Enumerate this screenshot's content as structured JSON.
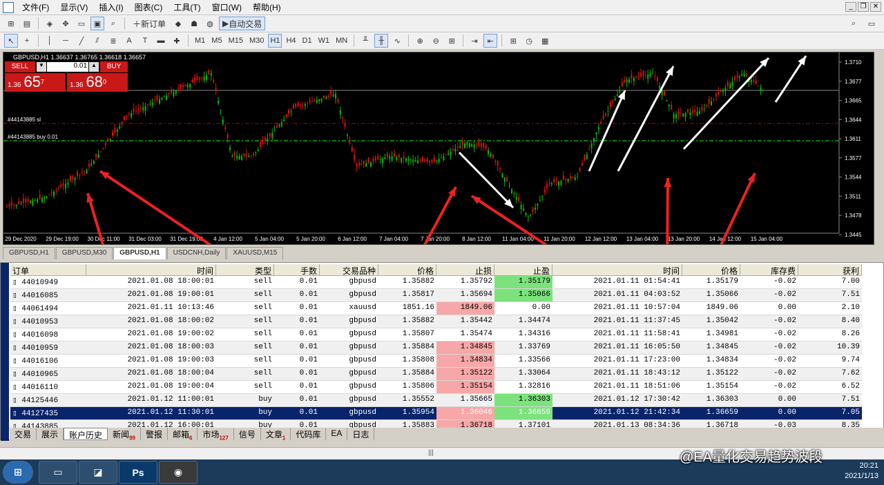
{
  "menu": {
    "items": [
      "文件(F)",
      "显示(V)",
      "插入(I)",
      "图表(C)",
      "工具(T)",
      "窗口(W)",
      "帮助(H)"
    ]
  },
  "toolbar": {
    "new_order": "新订单",
    "auto_trading": "自动交易",
    "timeframes": [
      "M1",
      "M5",
      "M15",
      "M30",
      "H1",
      "H4",
      "D1",
      "W1",
      "MN"
    ],
    "active_tf": "H1"
  },
  "chart": {
    "info": "GBPUSD,H1  1.36637 1.36765 1.36618 1.36657",
    "price_labels": [
      "1.3710",
      "1.3677",
      "1.3665",
      "1.3644",
      "1.3611",
      "1.3577",
      "1.3544",
      "1.3511",
      "1.3478",
      "1.3445"
    ],
    "time_labels": [
      "29 Dec 2020",
      "29 Dec 19:00",
      "30 Dec 11:00",
      "31 Dec 03:00",
      "31 Dec 19:00",
      "4 Jan 12:00",
      "5 Jan 04:00",
      "5 Jan 20:00",
      "6 Jan 12:00",
      "7 Jan 04:00",
      "7 Jan 20:00",
      "8 Jan 12:00",
      "11 Jan 04:00",
      "11 Jan 20:00",
      "12 Jan 12:00",
      "13 Jan 04:00",
      "13 Jan 20:00",
      "14 Jan 12:00",
      "15 Jan 04:00"
    ],
    "sl_label": "#44143885 sl",
    "buy_label": "#44143885 buy 0.01",
    "sell_btn": "SELL",
    "buy_btn": "BUY",
    "lot": "0.01",
    "sell_price_small": "1.36",
    "sell_price_big": "65",
    "sell_price_sup": "7",
    "buy_price_small": "1.36",
    "buy_price_big": "68",
    "buy_price_sup": "0",
    "colors": {
      "bull": "#00c000",
      "bear": "#e01010",
      "bg": "#000000"
    }
  },
  "chart_tabs": [
    "GBPUSD,H1",
    "GBPUSD,M30",
    "GBPUSD,H1",
    "USDCNH,Daily",
    "XAUUSD,M15"
  ],
  "table": {
    "headers": [
      "订单",
      "时间",
      "类型",
      "手数",
      "交易品种",
      "价格",
      "止损",
      "止盈",
      "时间",
      "价格",
      "库存费",
      "获利"
    ],
    "rows": [
      [
        "44010949",
        "2021.01.08 18:00:01",
        "sell",
        "0.01",
        "gbpusd",
        "1.35882",
        "1.35792",
        "1.35179",
        "2021.01.11 01:54:41",
        "1.35179",
        "-0.02",
        "7.00"
      ],
      [
        "44016085",
        "2021.01.08 19:00:01",
        "sell",
        "0.01",
        "gbpusd",
        "1.35817",
        "1.35694",
        "1.35066",
        "2021.01.11 04:03:52",
        "1.35066",
        "-0.02",
        "7.51"
      ],
      [
        "44061494",
        "2021.01.11 10:13:46",
        "sell",
        "0.01",
        "xauusd",
        "1851.16",
        "1849.06",
        "0.00",
        "2021.01.11 10:57:04",
        "1849.06",
        "0.00",
        "2.10"
      ],
      [
        "44010953",
        "2021.01.08 18:00:02",
        "sell",
        "0.01",
        "gbpusd",
        "1.35882",
        "1.35442",
        "1.34474",
        "2021.01.11 11:37:45",
        "1.35042",
        "-0.02",
        "8.40"
      ],
      [
        "44016098",
        "2021.01.08 19:00:02",
        "sell",
        "0.01",
        "gbpusd",
        "1.35807",
        "1.35474",
        "1.34316",
        "2021.01.11 11:58:41",
        "1.34981",
        "-0.02",
        "8.26"
      ],
      [
        "44010959",
        "2021.01.08 18:00:03",
        "sell",
        "0.01",
        "gbpusd",
        "1.35884",
        "1.34845",
        "1.33769",
        "2021.01.11 16:05:50",
        "1.34845",
        "-0.02",
        "10.39"
      ],
      [
        "44016106",
        "2021.01.08 19:00:03",
        "sell",
        "0.01",
        "gbpusd",
        "1.35808",
        "1.34834",
        "1.33566",
        "2021.01.11 17:23:00",
        "1.34834",
        "-0.02",
        "9.74"
      ],
      [
        "44010965",
        "2021.01.08 18:00:04",
        "sell",
        "0.01",
        "gbpusd",
        "1.35884",
        "1.35122",
        "1.33064",
        "2021.01.11 18:43:12",
        "1.35122",
        "-0.02",
        "7.62"
      ],
      [
        "44016110",
        "2021.01.08 19:00:04",
        "sell",
        "0.01",
        "gbpusd",
        "1.35806",
        "1.35154",
        "1.32816",
        "2021.01.11 18:51:06",
        "1.35154",
        "-0.02",
        "6.52"
      ],
      [
        "44125446",
        "2021.01.12 11:00:01",
        "buy",
        "0.01",
        "gbpusd",
        "1.35552",
        "1.35665",
        "1.36303",
        "2021.01.12 17:30:42",
        "1.36303",
        "0.00",
        "7.51"
      ],
      [
        "44127435",
        "2021.01.12 11:30:01",
        "buy",
        "0.01",
        "gbpusd",
        "1.35954",
        "1.36046",
        "1.36659",
        "2021.01.12 21:42:34",
        "1.36659",
        "0.00",
        "7.05"
      ],
      [
        "44143885",
        "2021.01.12 16:00:01",
        "buy",
        "0.01",
        "gbpusd",
        "1.35883",
        "1.36718",
        "1.37101",
        "2021.01.13 08:34:36",
        "1.36718",
        "-0.03",
        "8.35"
      ]
    ],
    "highlight": {
      "sl_red": [
        2,
        5,
        6,
        7,
        8,
        10,
        11
      ],
      "tp_green": [
        0,
        1,
        9,
        10
      ]
    },
    "selected_row": 10
  },
  "bottom_tabs": [
    {
      "label": "交易",
      "badge": ""
    },
    {
      "label": "展示",
      "badge": ""
    },
    {
      "label": "账户历史",
      "badge": ""
    },
    {
      "label": "新闻",
      "badge": "99"
    },
    {
      "label": "警报",
      "badge": ""
    },
    {
      "label": "邮箱",
      "badge": "6"
    },
    {
      "label": "市场",
      "badge": "127"
    },
    {
      "label": "信号",
      "badge": ""
    },
    {
      "label": "文章",
      "badge": "1"
    },
    {
      "label": "代码库",
      "badge": ""
    },
    {
      "label": "EA",
      "badge": ""
    },
    {
      "label": "日志",
      "badge": ""
    }
  ],
  "active_bottom_tab": "账户历史",
  "taskbar": {
    "time": "20:21",
    "date": "2021/1/13",
    "watermark": "@EA量化交易趋势波段"
  }
}
